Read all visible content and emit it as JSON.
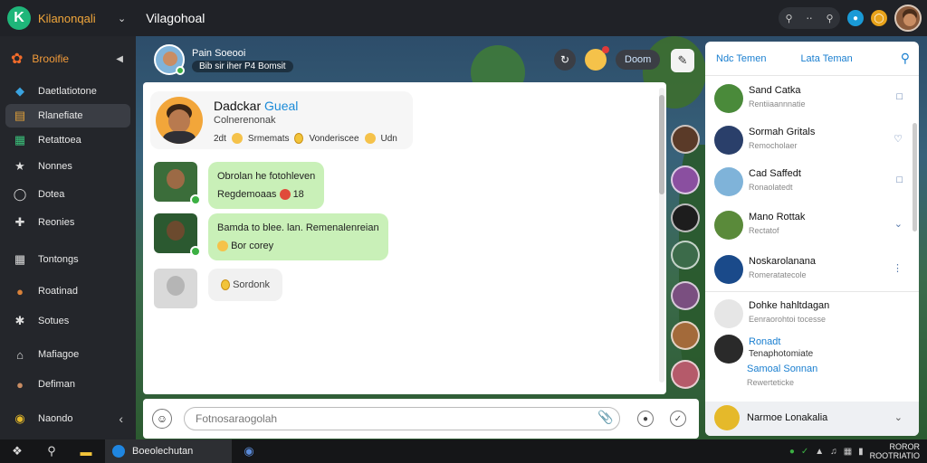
{
  "app": {
    "logo_letter": "K",
    "name": "Kilanonqali",
    "window_title": "Vilagohoal"
  },
  "topbar": {
    "search_hint": "ᴙ ᴔ",
    "notification_count": ""
  },
  "sidebar": {
    "header": "Brooifie",
    "items": [
      {
        "label": "Daetlatiotone",
        "icon": "dashboard-icon"
      },
      {
        "label": "Rlanefiate",
        "icon": "list-icon",
        "active": true
      },
      {
        "label": "Retattoea",
        "icon": "grid-icon"
      },
      {
        "label": "Nonnes",
        "icon": "star-icon"
      },
      {
        "label": "Dotea",
        "icon": "chat-icon"
      },
      {
        "label": "Reonies",
        "icon": "plus-icon"
      },
      {
        "label": "Tontongs",
        "icon": "table-icon"
      },
      {
        "label": "Roatinad",
        "icon": "person-icon"
      },
      {
        "label": "Sotues",
        "icon": "puzzle-icon"
      },
      {
        "label": "Mafiagoe",
        "icon": "home-icon"
      },
      {
        "label": "Defiman",
        "icon": "avatar-icon"
      },
      {
        "label": "Naondo",
        "icon": "globe-icon"
      }
    ]
  },
  "chat_header": {
    "name": "Pain Soeooi",
    "subtitle": "Bib sir iher P4 Bomsit",
    "pill_label": "Doom"
  },
  "profile_card": {
    "name": "Dadckar",
    "name_accent": "Gueal",
    "subtitle": "Colnerenonak",
    "meta_1": "2dt",
    "meta_2": "Srmemats",
    "meta_3": "Vonderiscee",
    "meta_4": "Udn"
  },
  "messages": [
    {
      "line1": "Obrolan he fotohleven",
      "line2": "Regdemoaas",
      "badge": "18"
    },
    {
      "line1": "Bamda to blee. lan. Remenalenreian",
      "line2": "Bor corey"
    },
    {
      "line1": "Sordonk"
    }
  ],
  "composer": {
    "placeholder": "Fotnosaraogolah"
  },
  "friends": {
    "tab_1": "Ndc Temen",
    "tab_2": "Lata Teman",
    "items": [
      {
        "name": "Sand Catka",
        "status": "Rentiiaannnatie"
      },
      {
        "name": "Sormah Gritals",
        "status": "Remocholaer"
      },
      {
        "name": "Cad Saffedt",
        "status": "Ronaolatedt"
      },
      {
        "name": "Mano Rottak",
        "status": "Rectatof"
      },
      {
        "name": "Noskarolanana",
        "status": "Romeratatecole"
      },
      {
        "name": "Dohke hahltdagan",
        "status": "Eenraorohtoi tocesse"
      },
      {
        "name": "Ronadt",
        "status": "Tenaphotomiate"
      },
      {
        "name": "Samoal Sonnan",
        "status": "Rewerteticke"
      },
      {
        "name": "Narmoe Lonakalia",
        "status": ""
      }
    ]
  },
  "taskbar": {
    "task_label": "Boeolechutan",
    "clock_time": "ROROR",
    "clock_date": "ROOTRIATIO"
  }
}
